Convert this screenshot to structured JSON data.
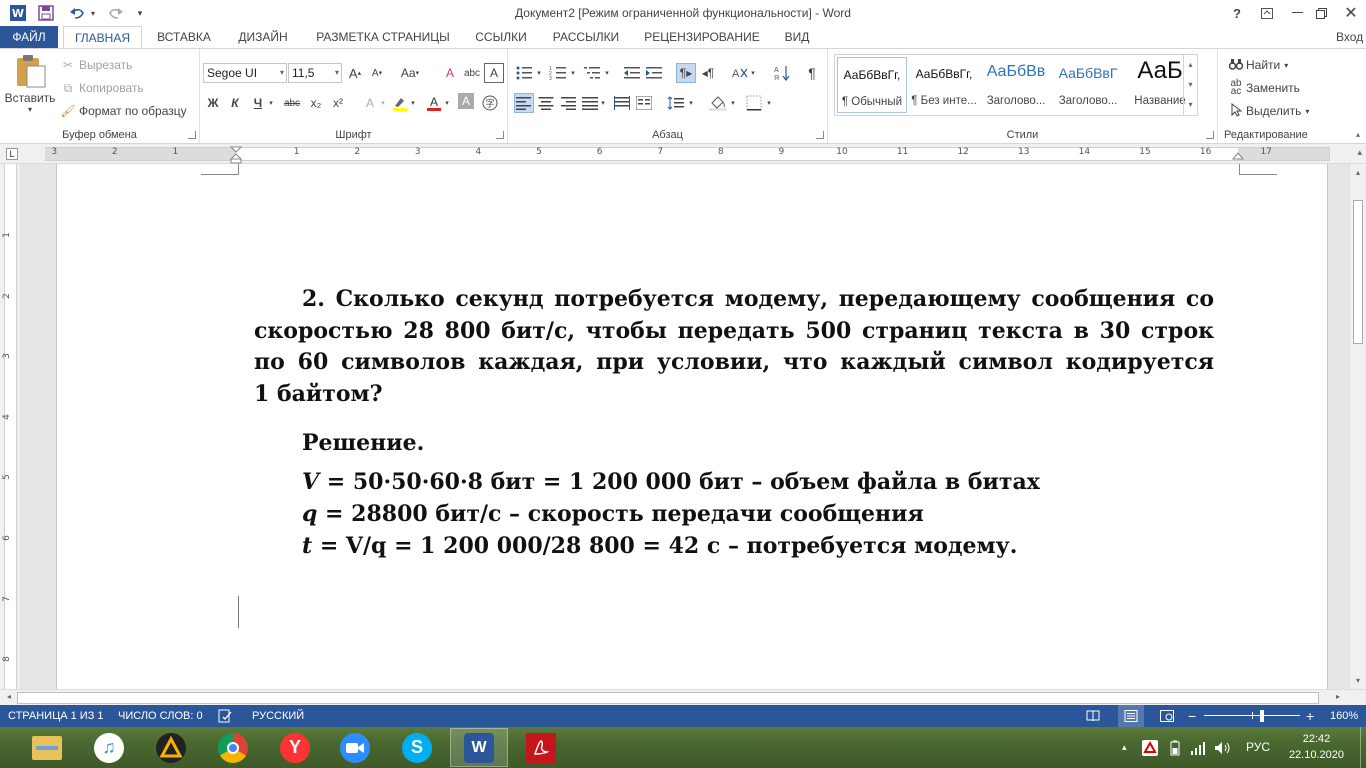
{
  "titlebar": {
    "title": "Документ2 [Режим ограниченной функциональности] - Word",
    "help": "?",
    "icons": [
      "word-app-icon",
      "save-icon",
      "undo-icon",
      "redo-icon",
      "customize-qat-icon"
    ]
  },
  "tabs": {
    "file": "ФАЙЛ",
    "items": [
      "ГЛАВНАЯ",
      "ВСТАВКА",
      "ДИЗАЙН",
      "РАЗМЕТКА СТРАНИЦЫ",
      "ССЫЛКИ",
      "РАССЫЛКИ",
      "РЕЦЕНЗИРОВАНИЕ",
      "ВИД"
    ],
    "active": "ГЛАВНАЯ",
    "signin": "Вход"
  },
  "clipboard": {
    "paste": "Вставить",
    "cut": "Вырезать",
    "copy": "Копировать",
    "format_painter": "Формат по образцу",
    "label": "Буфер обмена"
  },
  "font": {
    "name": "Segoe UI",
    "size": "11,5",
    "bold": "Ж",
    "italic": "К",
    "underline": "Ч",
    "strike": "abc",
    "subscript": "x₂",
    "superscript": "x²",
    "grow": "A",
    "shrink": "A",
    "case": "Aa",
    "label": "Шрифт"
  },
  "paragraph": {
    "label": "Абзац"
  },
  "styles": {
    "items": [
      {
        "sample": "АаБбВвГг,",
        "name": "¶ Обычный"
      },
      {
        "sample": "АаБбВвГг,",
        "name": "¶ Без инте..."
      },
      {
        "sample": "АаБбВв",
        "name": "Заголово..."
      },
      {
        "sample": "АаБбВвГ",
        "name": "Заголово..."
      },
      {
        "sample": "АаБ",
        "name": "Название"
      }
    ],
    "label": "Стили"
  },
  "editing": {
    "find": "Найти",
    "replace": "Заменить",
    "select": "Выделить",
    "label": "Редактирование"
  },
  "ruler": {
    "numbers": [
      "3",
      "2",
      "1",
      "1",
      "2",
      "3",
      "4",
      "5",
      "6",
      "7",
      "8",
      "9",
      "10",
      "11",
      "12",
      "13",
      "14",
      "15",
      "16",
      "17"
    ],
    "tab_selector": "L"
  },
  "vruler": {
    "numbers": [
      "1",
      "2",
      "3",
      "4",
      "5",
      "6",
      "7",
      "8"
    ]
  },
  "document": {
    "task_lines": [
      "2. Сколько секунд потребуется модему, передающему сообщения со",
      "скоростью 28 800 бит/с, чтобы передать 500 страниц текста в 30 строк",
      "по 60 символов каждая, при условии, что каждый символ кодируется",
      "1 байтом?"
    ],
    "solution_title": "Решение.",
    "solution_lines": [
      {
        "var": "V",
        "text": " = 50·50·60·8 бит = 1 200 000 бит – объем файла в битах"
      },
      {
        "var": "q",
        "text": " = 28800 бит/с – скорость передачи сообщения"
      },
      {
        "var": "t",
        "text": " = V/q = 1 200 000/28 800 = 42 с – потребуется модему."
      }
    ]
  },
  "statusbar": {
    "page": "СТРАНИЦА 1 ИЗ 1",
    "words": "ЧИСЛО СЛОВ: 0",
    "language": "РУССКИЙ",
    "zoom": "160%"
  },
  "taskbar": {
    "apps": [
      "file-explorer",
      "itunes",
      "aimp",
      "chrome",
      "yandex-browser",
      "zoom",
      "skype",
      "word",
      "acrobat"
    ],
    "tray_lang": "РУС",
    "time": "22:42",
    "date": "22.10.2020"
  },
  "colors": {
    "accent": "#2b579a",
    "taskbar": "#496830"
  }
}
